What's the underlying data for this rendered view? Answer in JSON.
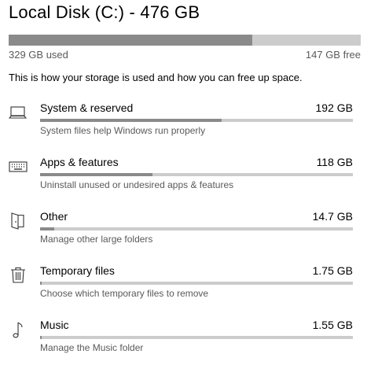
{
  "disk": {
    "title": "Local Disk (C:) - 476 GB",
    "used_label": "329 GB used",
    "free_label": "147 GB free",
    "used_fraction": 0.691,
    "description": "This is how your storage is used and how you can free up space."
  },
  "colors": {
    "bar_fill": "#8a8a8a",
    "bar_track": "#cccccc",
    "secondary_text": "#5a5a5a"
  },
  "categories": [
    {
      "name": "System & reserved",
      "size": "192 GB",
      "description": "System files help Windows run properly",
      "icon": "laptop-icon",
      "usage_fraction": 0.58
    },
    {
      "name": "Apps & features",
      "size": "118 GB",
      "description": "Uninstall unused or undesired apps & features",
      "icon": "keyboard-icon",
      "usage_fraction": 0.36
    },
    {
      "name": "Other",
      "size": "14.7 GB",
      "description": "Manage other large folders",
      "icon": "folder-icon",
      "usage_fraction": 0.045
    },
    {
      "name": "Temporary files",
      "size": "1.75 GB",
      "description": "Choose which temporary files to remove",
      "icon": "trash-icon",
      "usage_fraction": 0.005
    },
    {
      "name": "Music",
      "size": "1.55 GB",
      "description": "Manage the Music folder",
      "icon": "music-note-icon",
      "usage_fraction": 0.005
    }
  ]
}
